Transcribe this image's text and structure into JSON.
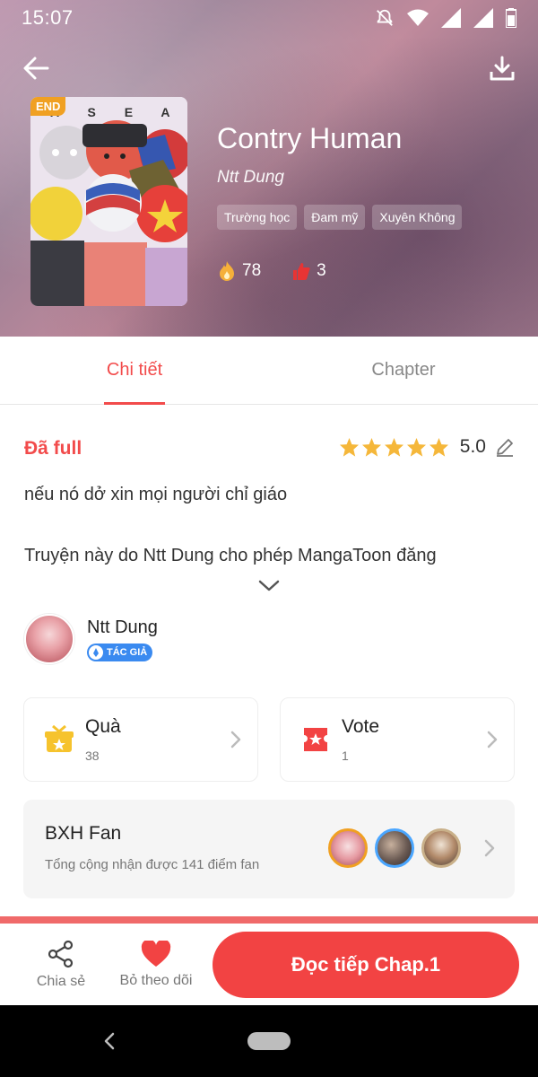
{
  "status_bar": {
    "time": "15:07"
  },
  "book": {
    "title": "Contry Human",
    "author": "Ntt Dung",
    "end_badge": "END",
    "cover_text": "A S E A N",
    "tags": [
      "Trường học",
      "Đam mỹ",
      "Xuyên Không"
    ],
    "fire_count": "78",
    "like_count": "3"
  },
  "tabs": {
    "detail": "Chi tiết",
    "chapter": "Chapter"
  },
  "detail": {
    "status": "Đã full",
    "rating": "5.0",
    "description_line1": "nếu nó dở xin mọi người chỉ giáo",
    "description_line2": "Truyện này do Ntt Dung cho phép MangaToon đăng"
  },
  "author_block": {
    "name": "Ntt Dung",
    "badge": "TÁC GIẢ"
  },
  "gift": {
    "label": "Quà",
    "count": "38"
  },
  "vote": {
    "label": "Vote",
    "count": "1"
  },
  "fan_rank": {
    "title": "BXH Fan",
    "subtitle": "Tổng cộng nhận được 141 điểm fan"
  },
  "bottom_bar": {
    "share": "Chia sẻ",
    "unfollow": "Bỏ theo dõi",
    "read_button": "Đọc tiếp Chap.1"
  },
  "colors": {
    "accent": "#f24b4b",
    "end_badge": "#f0a022",
    "star": "#f5b73a"
  }
}
